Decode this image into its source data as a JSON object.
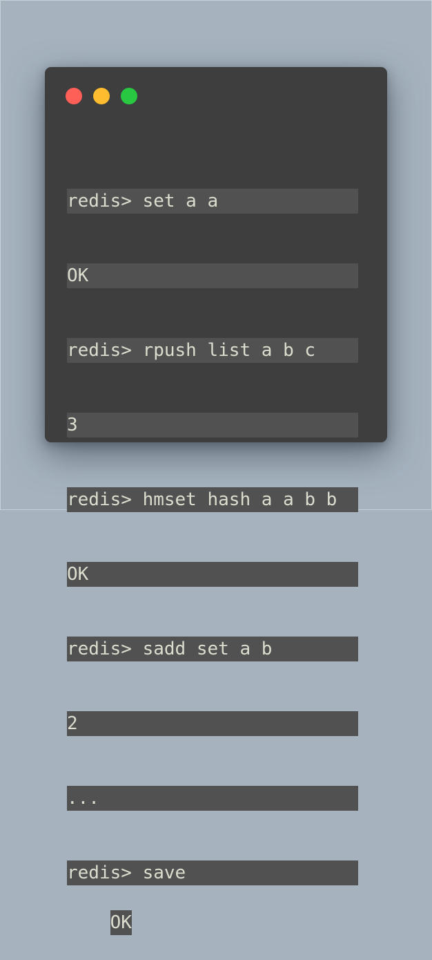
{
  "window": {
    "controls": [
      {
        "name": "close",
        "color": "#fe5f57"
      },
      {
        "name": "minimize",
        "color": "#febc2e"
      },
      {
        "name": "zoom",
        "color": "#28c840"
      }
    ]
  },
  "terminal": {
    "lines": [
      "redis> set a a",
      "OK",
      "redis> rpush list a b c",
      "3",
      "redis> hmset hash a a b b",
      "OK",
      "redis> sadd set a b",
      "2",
      "...",
      "redis> save",
      "OK"
    ],
    "colors": {
      "text": "#dcdccf",
      "selection": "#515151",
      "window": "#3e3e3e",
      "backdrop": "#a6b3bf"
    }
  }
}
